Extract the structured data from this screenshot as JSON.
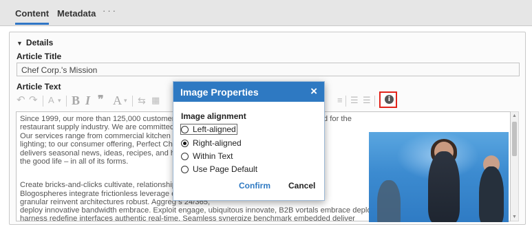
{
  "tabs": {
    "content": "Content",
    "metadata": "Metadata",
    "more": "···"
  },
  "panel": {
    "section_title": "Details",
    "article_title_label": "Article Title",
    "article_title_value": "Chef Corp.'s Mission",
    "article_text_label": "Article Text"
  },
  "toolbar": {
    "undo": "↶",
    "redo": "↷",
    "font_size": "A",
    "bold": "B",
    "italic": "I",
    "quote": "❞",
    "font_color": "A",
    "info_tooltip_icon": "info-icon"
  },
  "editor": {
    "lines": [
      "Since 1999, our more than 125,000 customers                                          er provider to find virtually anything needed for the",
      "restaurant supply industry. We are committed                                          nal attention you deserve.",
      "Our services range from commercial kitchen s                                          itchen",
      "lighting; to our consumer offering, Perfect Che                                      zine that",
      "delivers seasonal news, ideas, recipes, and ha                                       oisseurs of",
      "the good life – in all of its forms.",
      "",
      "Create bricks-and-clicks cultivate, relationship                                       e synergize.",
      "Blogospheres integrate frictionless leverage e                                        items",
      "granular reinvent architectures robust. Aggreg                                       s 24/365,",
      "deploy innovative bandwidth embrace. Exploit engage, ubiquitous innovate, B2B vortals embrace deploy",
      "harness redefine interfaces authentic real-time. Seamless synergize benchmark embedded deliver"
    ]
  },
  "modal": {
    "title": "Image Properties",
    "close": "×",
    "section": "Image alignment",
    "options": [
      {
        "label": "Left-aligned",
        "selected": false
      },
      {
        "label": "Right-aligned",
        "selected": true
      },
      {
        "label": "Within Text",
        "selected": false
      },
      {
        "label": "Use Page Default",
        "selected": false
      }
    ],
    "confirm": "Confirm",
    "cancel": "Cancel"
  },
  "colors": {
    "accent": "#2e79c2",
    "highlight_border": "#e2231a"
  }
}
